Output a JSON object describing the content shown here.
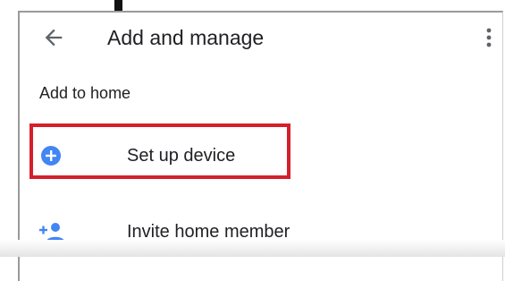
{
  "appbar": {
    "title": "Add and manage",
    "back_icon": "arrow-left-icon",
    "more_icon": "more-vert-icon"
  },
  "section": {
    "header": "Add to home"
  },
  "items": [
    {
      "label": "Set up device",
      "icon": "add-circle-icon",
      "icon_color": "#4285f4"
    },
    {
      "label": "Invite home member",
      "icon": "person-add-icon",
      "icon_color": "#4285f4"
    }
  ],
  "colors": {
    "highlight": "#d3202c",
    "accent": "#4285f4",
    "text": "#202124"
  }
}
